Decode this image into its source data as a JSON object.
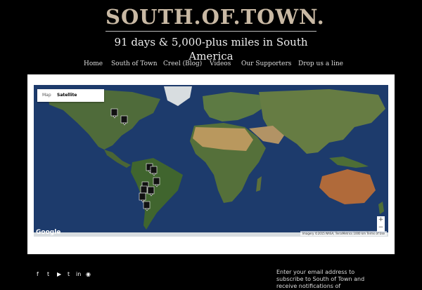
{
  "header": {
    "title": "SOUTH.OF.TOWN.",
    "tagline": "91 days & 5,000-plus miles in South America"
  },
  "nav": {
    "items": [
      {
        "label": "Home"
      },
      {
        "label": "South of Town"
      },
      {
        "label": "Creel (Blog)"
      },
      {
        "label": "Videos"
      },
      {
        "label": "Our Supporters"
      },
      {
        "label": "Drop us a line"
      }
    ]
  },
  "map": {
    "type_control": {
      "map_label": "Map",
      "satellite_label": "Satellite",
      "selected": "Satellite"
    },
    "zoom_in_label": "+",
    "zoom_out_label": "−",
    "logo_text": "Google",
    "attribution": "Imagery ©2015 NASA, TerraMetrics   1000 km   Terms of Use",
    "marker_icon": "photo-marker-icon",
    "colors": {
      "ocean": "#1d3b6c",
      "land": "#4f6b3a",
      "desert": "#b9985e",
      "marker": "#111111"
    }
  },
  "footer": {
    "social_icons": [
      "facebook-icon",
      "twitter-icon",
      "youtube-icon",
      "tumblr-icon",
      "linkedin-icon",
      "rss-icon"
    ],
    "social_glyphs": [
      "f",
      "t",
      "▶",
      "t",
      "in",
      "◉"
    ],
    "subscribe_text": "Enter your email address to subscribe to South of Town and receive notifications of"
  }
}
